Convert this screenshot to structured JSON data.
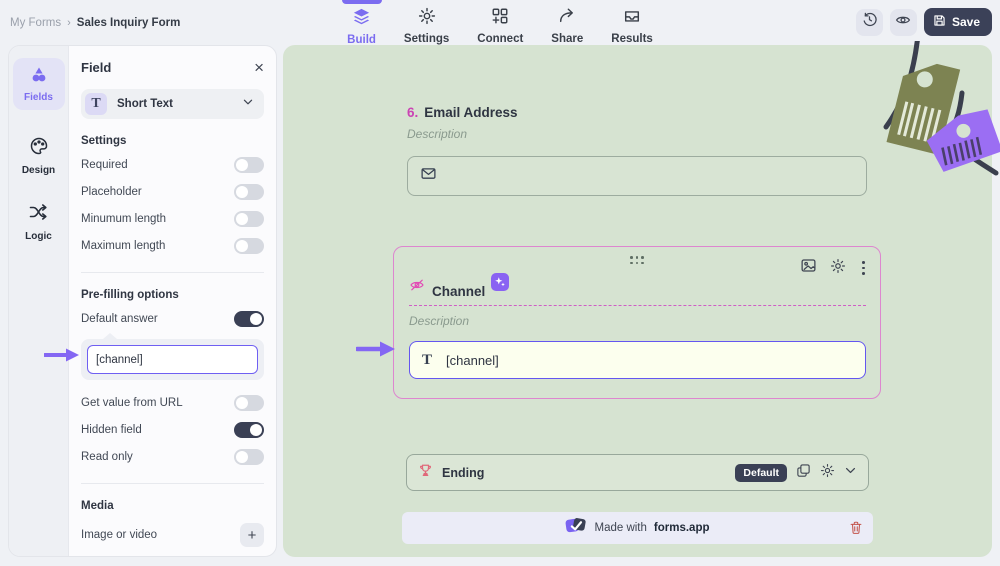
{
  "topbar": {
    "breadcrumb": {
      "parent": "My Forms",
      "separator": "›",
      "current": "Sales Inquiry Form"
    },
    "tabs": [
      {
        "label": "Build",
        "icon": "layers-icon",
        "active": true
      },
      {
        "label": "Settings",
        "icon": "gear-icon",
        "active": false
      },
      {
        "label": "Connect",
        "icon": "grid-plus-icon",
        "active": false
      },
      {
        "label": "Share",
        "icon": "share-arrow-icon",
        "active": false
      },
      {
        "label": "Results",
        "icon": "inbox-icon",
        "active": false
      }
    ],
    "actions": {
      "history_icon": "history-icon",
      "preview_icon": "eye-icon",
      "save_label": "Save"
    }
  },
  "rail": {
    "items": [
      {
        "label": "Fields",
        "icon": "shapes-icon",
        "active": true
      },
      {
        "label": "Design",
        "icon": "palette-icon",
        "active": false
      },
      {
        "label": "Logic",
        "icon": "shuffle-icon",
        "active": false
      }
    ]
  },
  "panel": {
    "title": "Field",
    "close_glyph": "×",
    "field_type": "Short Text",
    "settings_title": "Settings",
    "toggles": [
      {
        "label": "Required",
        "on": false
      },
      {
        "label": "Placeholder",
        "on": false
      },
      {
        "label": "Minumum length",
        "on": false
      },
      {
        "label": "Maximum length",
        "on": false
      }
    ],
    "prefill_title": "Pre-filling options",
    "default_answer": {
      "label": "Default answer",
      "on": true,
      "value": "[channel]"
    },
    "more_toggles": [
      {
        "label": "Get value from URL",
        "on": false
      },
      {
        "label": "Hidden field",
        "on": true
      },
      {
        "label": "Read only",
        "on": false
      }
    ],
    "media_title": "Media",
    "media_row_label": "Image or video",
    "plus_glyph": "+"
  },
  "canvas": {
    "email_question": {
      "number": "6.",
      "title": "Email Address",
      "description": "Description"
    },
    "channel_field": {
      "title": "Channel",
      "description": "Description",
      "value": "[channel]"
    },
    "ending": {
      "label": "Ending",
      "badge": "Default"
    },
    "footer": {
      "prefix": "Made with",
      "brand": "forms.app"
    }
  },
  "colors": {
    "accent_purple": "#7b6cf0",
    "arrow_purple": "#8467f3",
    "magenta": "#cb44b4",
    "card_border_pink": "#dd86cf",
    "canvas_green": "#d6e3d1",
    "dark_navy": "#3a4055",
    "channel_input_bg": "#fcffee",
    "channel_input_border": "#6456f0",
    "trash_red": "#c3544c",
    "trophy_red": "#e0697a"
  }
}
